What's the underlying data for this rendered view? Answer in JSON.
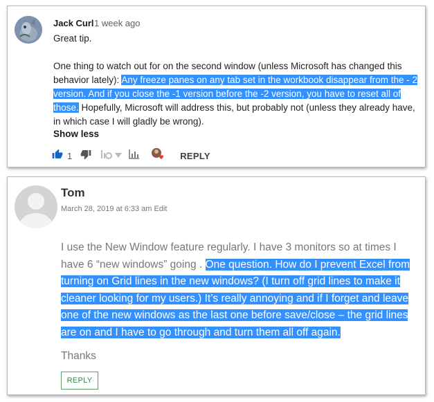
{
  "comment1": {
    "author": "Jack Curl",
    "time": "1 week ago",
    "line1": "Great tip.",
    "para_plain": "One thing to watch out for on the second window (unless Microsoft has changed this behavior lately): ",
    "para_highlight": "Any freeze panes on any tab set in the workbook disappear from the - 2 version. And if you close the -1 version before the -2 version, you have to reset all of those.",
    "para_rest": " Hopefully, Microsoft will address this, but probably not (unless they already have, in which case I will gladly be wrong).",
    "show_less": "Show less",
    "like_count": "1",
    "reply_label": "REPLY"
  },
  "comment2": {
    "author": "Tom",
    "date": "March 28, 2019 at 6:33 am",
    "edit_label": "Edit",
    "text_plain": "I use the New Window feature regularly. I have 3 monitors so at times I have 6 “new windows” going . ",
    "text_highlight": "One question. How do I prevent Excel from turning on Grid lines in the new windows? (I turn off grid lines to make it cleaner looking for my users.) It’s really annoying and if I forget and leave one of the new windows as the last one before save/close – the grid lines are on and I have to go through and turn them all off again.",
    "thanks": "Thanks",
    "reply_label": "REPLY"
  },
  "colors": {
    "highlight": "#3390ff",
    "like_blue": "#1565c0",
    "reply_green": "#2f8a45"
  },
  "icons": [
    "thumbs-up-icon",
    "thumbs-down-icon",
    "vote-down-icon",
    "chevron-down-icon",
    "stats-bar-icon",
    "reactions-icon"
  ]
}
